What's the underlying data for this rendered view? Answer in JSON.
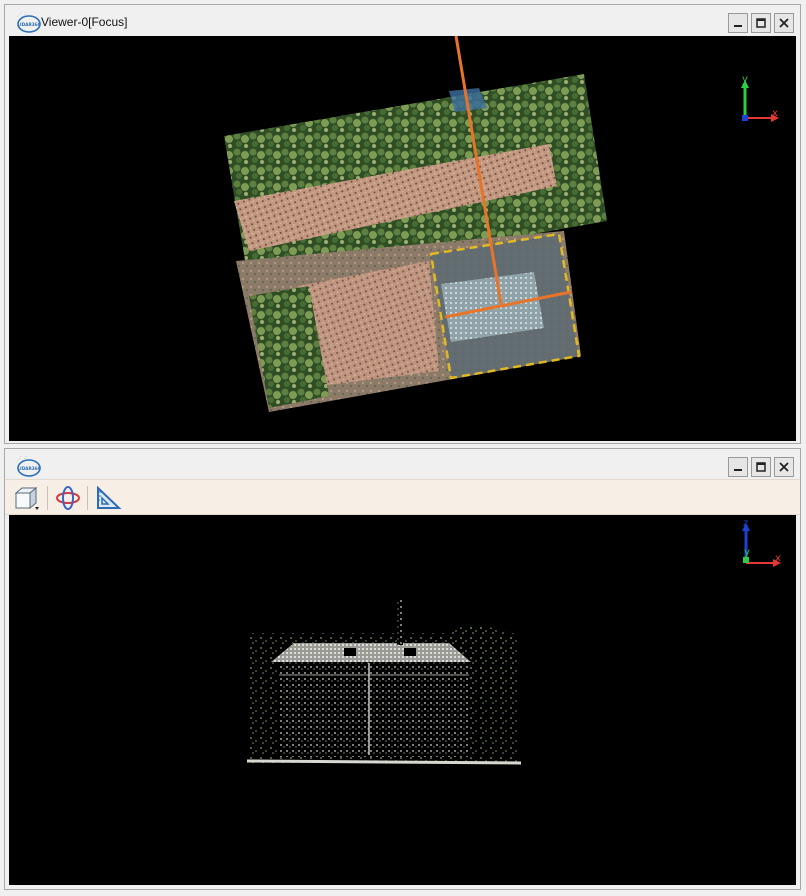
{
  "top_pane": {
    "title": "Viewer-0[Focus]",
    "logo_text": "LIDAR360",
    "buttons": [
      "minimize-icon",
      "maximize-icon",
      "close-icon"
    ],
    "axis": {
      "x": "x",
      "y": "y"
    }
  },
  "bottom_pane": {
    "title": "",
    "logo_text": "LIDAR360",
    "buttons": [
      "minimize-icon",
      "maximize-icon",
      "close-icon"
    ],
    "toolbar": [
      "view-cube-icon",
      "orbit-icon",
      "measure-triangle-icon"
    ],
    "axis": {
      "x": "x",
      "y": "y",
      "z": "z"
    }
  },
  "colors": {
    "viewport_bg": "#000000",
    "profile_line": "#e8742a",
    "selection_border": "#f0c419",
    "toolbar_bg": "#f7efe6",
    "axis_x": "#e53935",
    "axis_y": "#2ecc40",
    "axis_z": "#1e40d6"
  }
}
